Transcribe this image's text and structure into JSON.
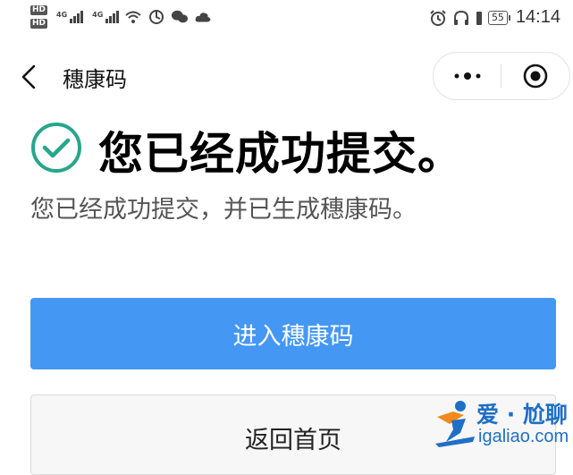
{
  "status_bar": {
    "hd_labels": [
      "HD",
      "HD"
    ],
    "network_1": "4G",
    "network_2": "4G",
    "battery_level": "55",
    "time": "14:14"
  },
  "nav": {
    "title": "穗康码"
  },
  "main": {
    "heading": "您已经成功提交。",
    "description": "您已经成功提交，并已生成穗康码。",
    "primary_button": "进入穗康码",
    "secondary_button": "返回首页"
  },
  "watermark": {
    "title": "爱 · 尬聊",
    "url": "igaliao.com"
  },
  "colors": {
    "primary": "#4497f2",
    "success": "#27a68c",
    "watermark_blue": "#1f6fc6",
    "watermark_orange": "#f08a1c"
  },
  "icons": [
    "signal-icon",
    "wifi-icon",
    "alarm-icon",
    "headphone-icon",
    "battery-icon",
    "back-icon",
    "more-icon",
    "close-mini-program-icon",
    "success-check-icon"
  ]
}
